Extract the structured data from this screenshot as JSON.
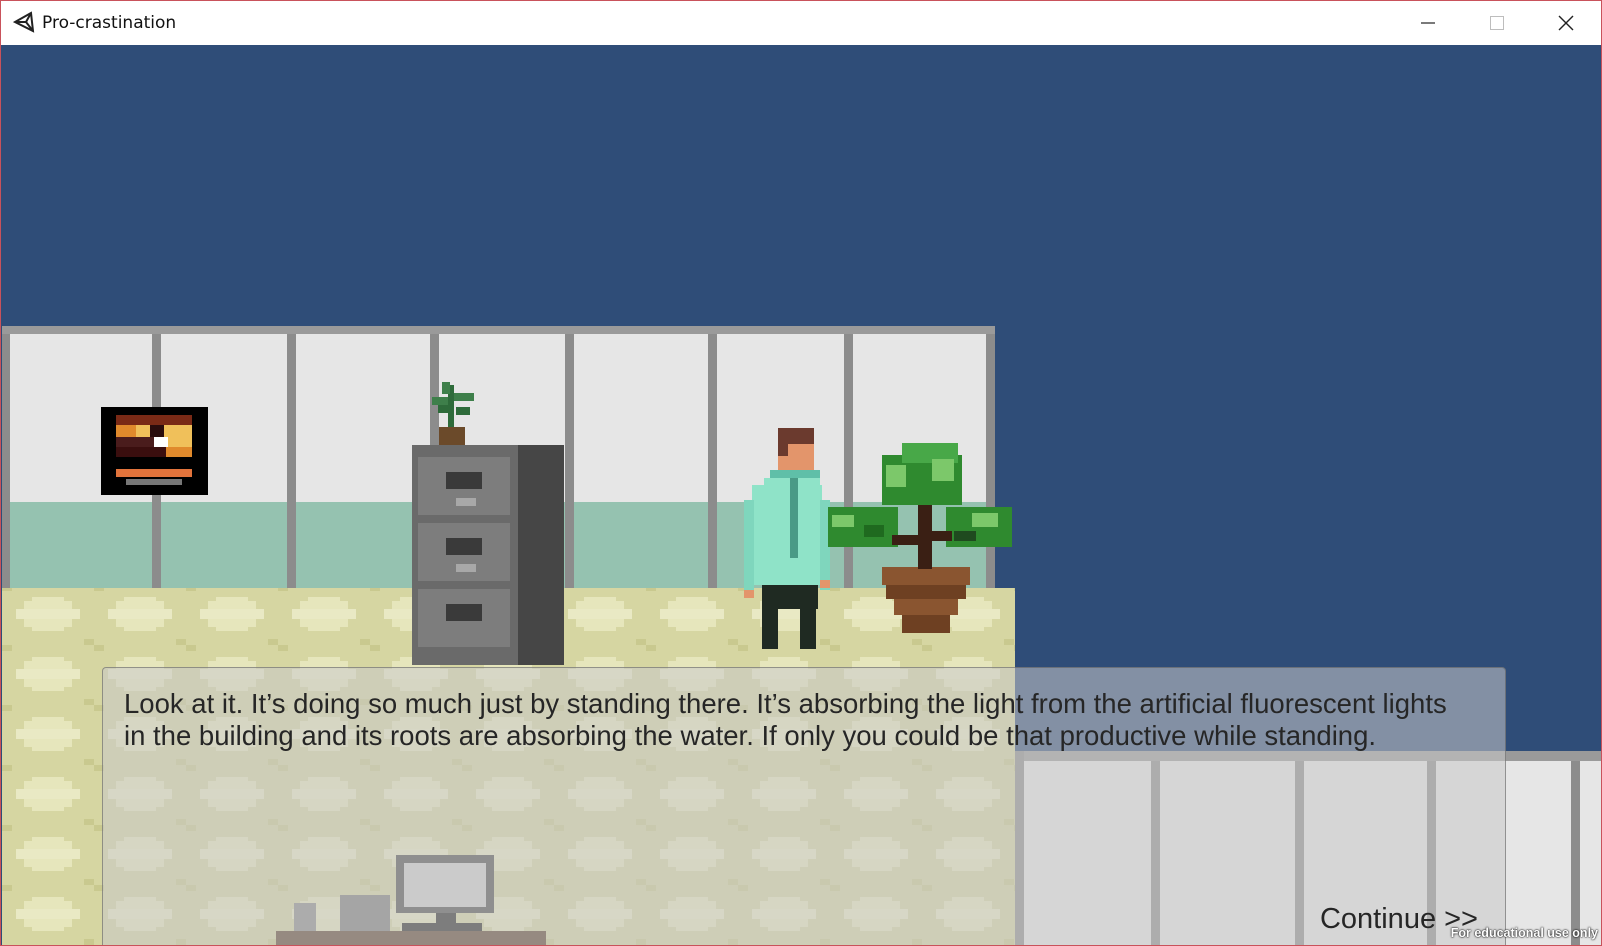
{
  "window": {
    "title": "Pro-crastination",
    "border_color": "#c9525b"
  },
  "icons": {
    "app": "unity-logo-icon",
    "minimize": "minimize-icon",
    "maximize": "maximize-icon",
    "close": "close-icon"
  },
  "scene": {
    "sky_color": "#2f4d78",
    "wall_color": "#e6e6e6",
    "wainscot_color": "#95c2b0",
    "carpet_color": "#dcdcaa"
  },
  "dialogue": {
    "text": "Look at it. It’s doing so much just by standing there. It’s absorbing the light from the artificial fluorescent lights in the building and its roots are absorbing the water. If only you could be that productive while standing.",
    "continue_label": "Continue >>"
  },
  "watermark": "For educational use only"
}
